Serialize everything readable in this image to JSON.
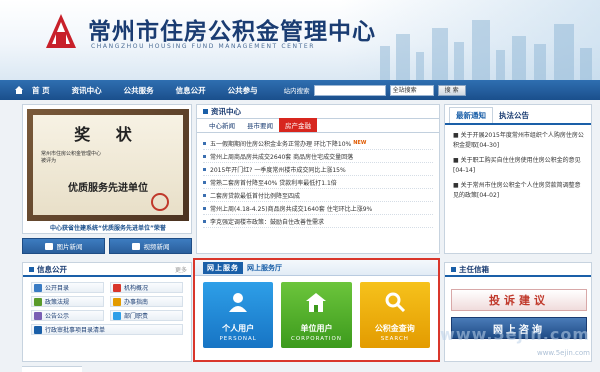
{
  "header": {
    "title": "常州市住房公积金管理中心",
    "subtitle": "CHANGZHOU HOUSING FUND MANAGEMENT CENTER"
  },
  "nav": {
    "items": [
      "首 页",
      "资讯中心",
      "公共服务",
      "信息公开",
      "公共参与"
    ],
    "search_label": "站内搜索",
    "search_placeholder": "",
    "search_select": "全站搜索",
    "search_button": "搜 索"
  },
  "award": {
    "title": "奖 状",
    "text_line1": "常州市住房公积金管理中心",
    "text_line2": "被评为",
    "big": "优质服务先进单位",
    "caption": "中心获省住建系统“优质服务先进单位”荣誉",
    "links": [
      "图片新闻",
      "视频新闻"
    ]
  },
  "info_open": {
    "title": "信息公开",
    "more": "更多",
    "items": [
      "公开目录",
      "机构概况",
      "政策法规",
      "办事指南",
      "公告公示",
      "部门职责",
      "行政审批事项目录清单"
    ]
  },
  "news": {
    "heading": "资讯中心",
    "tabs": [
      "中心新闻",
      "县市要闻",
      "房产金融"
    ],
    "items": [
      "五一假期期间住房公积金业务正常办理 环比下降10%",
      "常州上周商品房共成交2640套 商品房住宅成交量回落",
      "2015年开门红? 一季度常州楼市成交同比上涨15%",
      "常熟二套房首付降至40% 贷款利率最低打1.1倍",
      "二套房贷款最低首付比例降至四成",
      "常州上周(4.18-4.25)商品房共成交1640套 住宅环比上涨9%",
      "李克强定调楼市政策：鼓励自住改善性需求"
    ]
  },
  "online": {
    "tag": "网上服务",
    "title": "网上服务厅",
    "tiles": [
      {
        "name": "个人用户",
        "en": "PERSONAL"
      },
      {
        "name": "单位用户",
        "en": "CORPORATION"
      },
      {
        "name": "公积金查询",
        "en": "SEARCH"
      }
    ]
  },
  "notice": {
    "tabs": [
      "最新通知",
      "执法公告"
    ],
    "items": [
      "■ 关于开展2015年度常州市组织个人购房住房公积金提取[04-30]",
      "■ 关于职工购买自住住房使用住房公积金的意见[04-14]",
      "■ 关于常州市住房公积金个人住房贷款简调整意见的政策[04-02]"
    ]
  },
  "hotline": {
    "title": "主任信箱",
    "banner1": "投诉建议",
    "banner2": "网上咨询"
  },
  "watermark": {
    "line1": "www.5ejin.com",
    "line2": "www.5ejin.com"
  }
}
